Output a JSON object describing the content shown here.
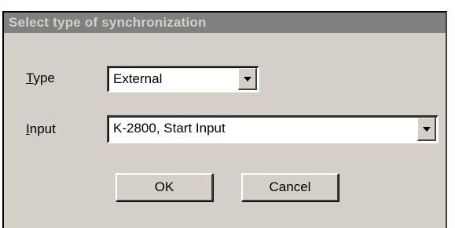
{
  "dialog": {
    "title": "Select type of synchronization"
  },
  "type_field": {
    "label_accel": "T",
    "label_rest": "ype",
    "value": "External"
  },
  "input_field": {
    "label_accel": "I",
    "label_rest": "nput",
    "value": "K-2800, Start Input"
  },
  "buttons": {
    "ok": "OK",
    "cancel": "Cancel"
  },
  "icons": {
    "dropdown": "chevron-down-icon"
  },
  "colors": {
    "dialog_bg": "#d4d0c8",
    "titlebar_bg": "#808080",
    "title_text": "#d4d0c8"
  }
}
